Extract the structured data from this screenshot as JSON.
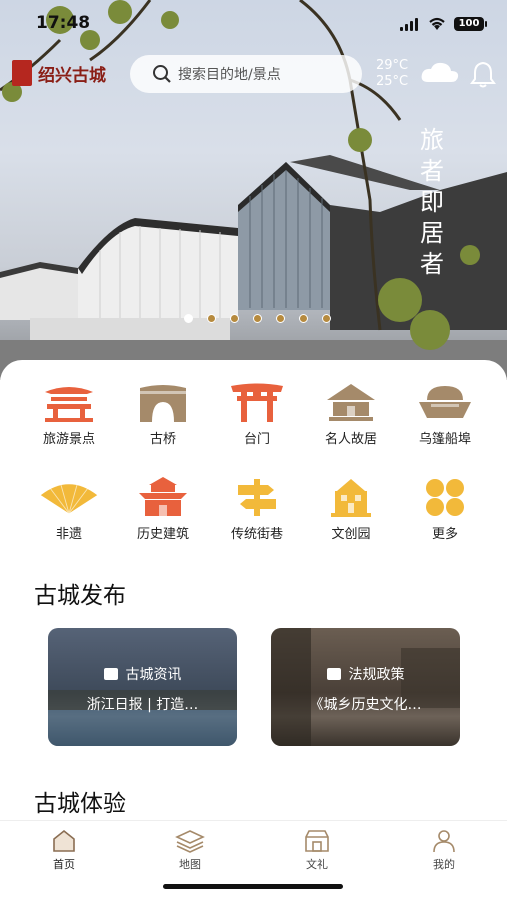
{
  "status": {
    "time": "17:48",
    "battery": "100"
  },
  "header": {
    "logo_text": "绍兴古城",
    "search_placeholder": "搜索目的地/景点",
    "temp_high": "29°C",
    "temp_low": "25°C"
  },
  "hero": {
    "slogan": "旅者即居者",
    "carousel_count": 7,
    "carousel_active": 1
  },
  "categories": [
    {
      "label": "旅游景点",
      "icon": "pavilion-icon",
      "color": "#e8613d"
    },
    {
      "label": "古桥",
      "icon": "bridge-icon",
      "color": "#a58a6a"
    },
    {
      "label": "台门",
      "icon": "gate-icon",
      "color": "#e8613d"
    },
    {
      "label": "名人故居",
      "icon": "house-icon",
      "color": "#a58a6a"
    },
    {
      "label": "乌篷船埠",
      "icon": "boat-icon",
      "color": "#a58a6a"
    },
    {
      "label": "非遗",
      "icon": "fan-icon",
      "color": "#f2b93a"
    },
    {
      "label": "历史建筑",
      "icon": "building-icon",
      "color": "#e8613d"
    },
    {
      "label": "传统街巷",
      "icon": "signpost-icon",
      "color": "#f2b93a"
    },
    {
      "label": "文创园",
      "icon": "park-icon",
      "color": "#f2b93a"
    },
    {
      "label": "更多",
      "icon": "more-grid-icon",
      "color": "#f2b93a"
    }
  ],
  "sections": {
    "publish": "古城发布",
    "experience": "古城体验"
  },
  "cards": [
    {
      "category": "古城资讯",
      "title": "浙江日报 | 打造…"
    },
    {
      "category": "法规政策",
      "title": "《城乡历史文化…"
    }
  ],
  "tabs": [
    {
      "label": "首页",
      "icon": "home-icon",
      "active": true
    },
    {
      "label": "地图",
      "icon": "map-layers-icon",
      "active": false
    },
    {
      "label": "文礼",
      "icon": "shop-icon",
      "active": false
    },
    {
      "label": "我的",
      "icon": "user-icon",
      "active": false
    }
  ]
}
